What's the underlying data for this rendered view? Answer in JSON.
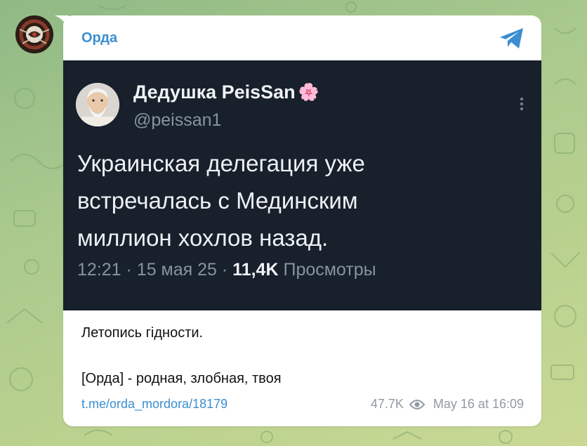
{
  "channel": {
    "name": "Орда"
  },
  "tweet": {
    "author_name": "Дедушка PeisSan",
    "author_emoji": "🌸",
    "handle": "@peissan1",
    "text": "Украинская делегация уже\nвстречалась с Мединским\nмиллион хохлов назад.",
    "time": "12:21",
    "date": "15 мая 25",
    "views_count": "11,4K",
    "views_label": "Просмотры"
  },
  "post": {
    "caption": "Летопись гідности.",
    "signature": "[Орда] - родная, злобная, твоя",
    "link": "t.me/orda_mordora/18179",
    "views": "47.7K",
    "timestamp": "May 16 at 16:09"
  },
  "icons": {
    "share": "telegram-share-icon",
    "views": "eye-icon",
    "more": "more-vertical-icon"
  },
  "colors": {
    "accent": "#3b8ed1",
    "tweet_bg": "#17202b",
    "wallpaper": "#a9c98d"
  }
}
